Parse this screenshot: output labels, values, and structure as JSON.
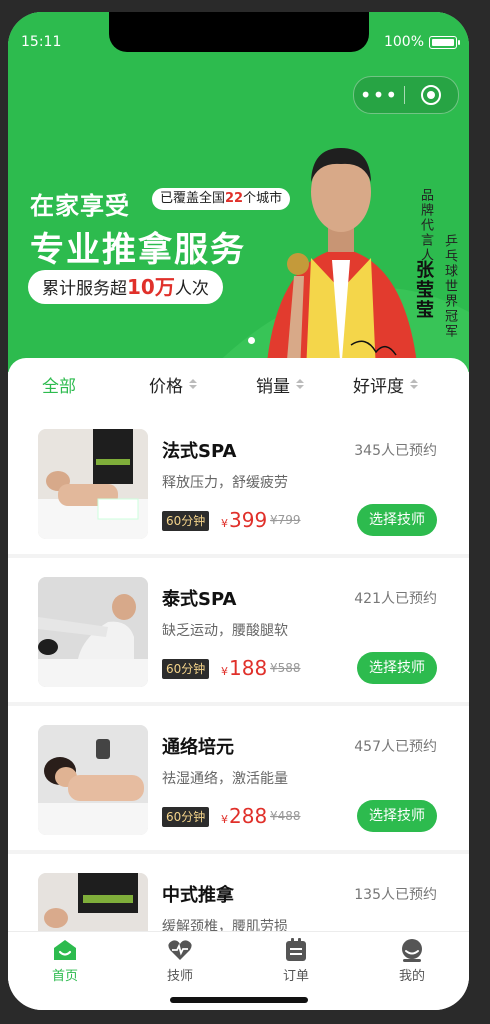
{
  "status": {
    "time": "15:11",
    "battery": "100%"
  },
  "banner": {
    "line1": "在家享受",
    "coverage_prefix": "已覆盖全国",
    "coverage_num": "22",
    "coverage_suffix": "个城市",
    "line2": "专业推拿服务",
    "served_prefix": "累计服务超",
    "served_num": "10万",
    "served_suffix": "人次",
    "brand_text": "品牌代言人",
    "name_text": "张莹莹",
    "champion_text": "乒乓球世界冠军"
  },
  "filters": {
    "all": "全部",
    "price": "价格",
    "sales": "销量",
    "rating": "好评度"
  },
  "services": [
    {
      "title": "法式SPA",
      "booked": "345人已预约",
      "desc": "释放压力，舒缓疲劳",
      "duration": "60分钟",
      "currency": "¥",
      "price": "399",
      "original": "¥799",
      "action": "选择技师"
    },
    {
      "title": "泰式SPA",
      "booked": "421人已预约",
      "desc": "缺乏运动，腰酸腿软",
      "duration": "60分钟",
      "currency": "¥",
      "price": "188",
      "original": "¥588",
      "action": "选择技师"
    },
    {
      "title": "通络培元",
      "booked": "457人已预约",
      "desc": "祛湿通络，激活能量",
      "duration": "60分钟",
      "currency": "¥",
      "price": "288",
      "original": "¥488",
      "action": "选择技师"
    },
    {
      "title": "中式推拿",
      "booked": "135人已预约",
      "desc": "缓解颈椎，腰肌劳损",
      "duration": "",
      "currency": "",
      "price": "",
      "original": "",
      "action": ""
    }
  ],
  "tabs": {
    "home": "首页",
    "tech": "技师",
    "order": "订单",
    "mine": "我的"
  },
  "colors": {
    "brand_green": "#2dbb4e",
    "price_red": "#e0302a"
  }
}
